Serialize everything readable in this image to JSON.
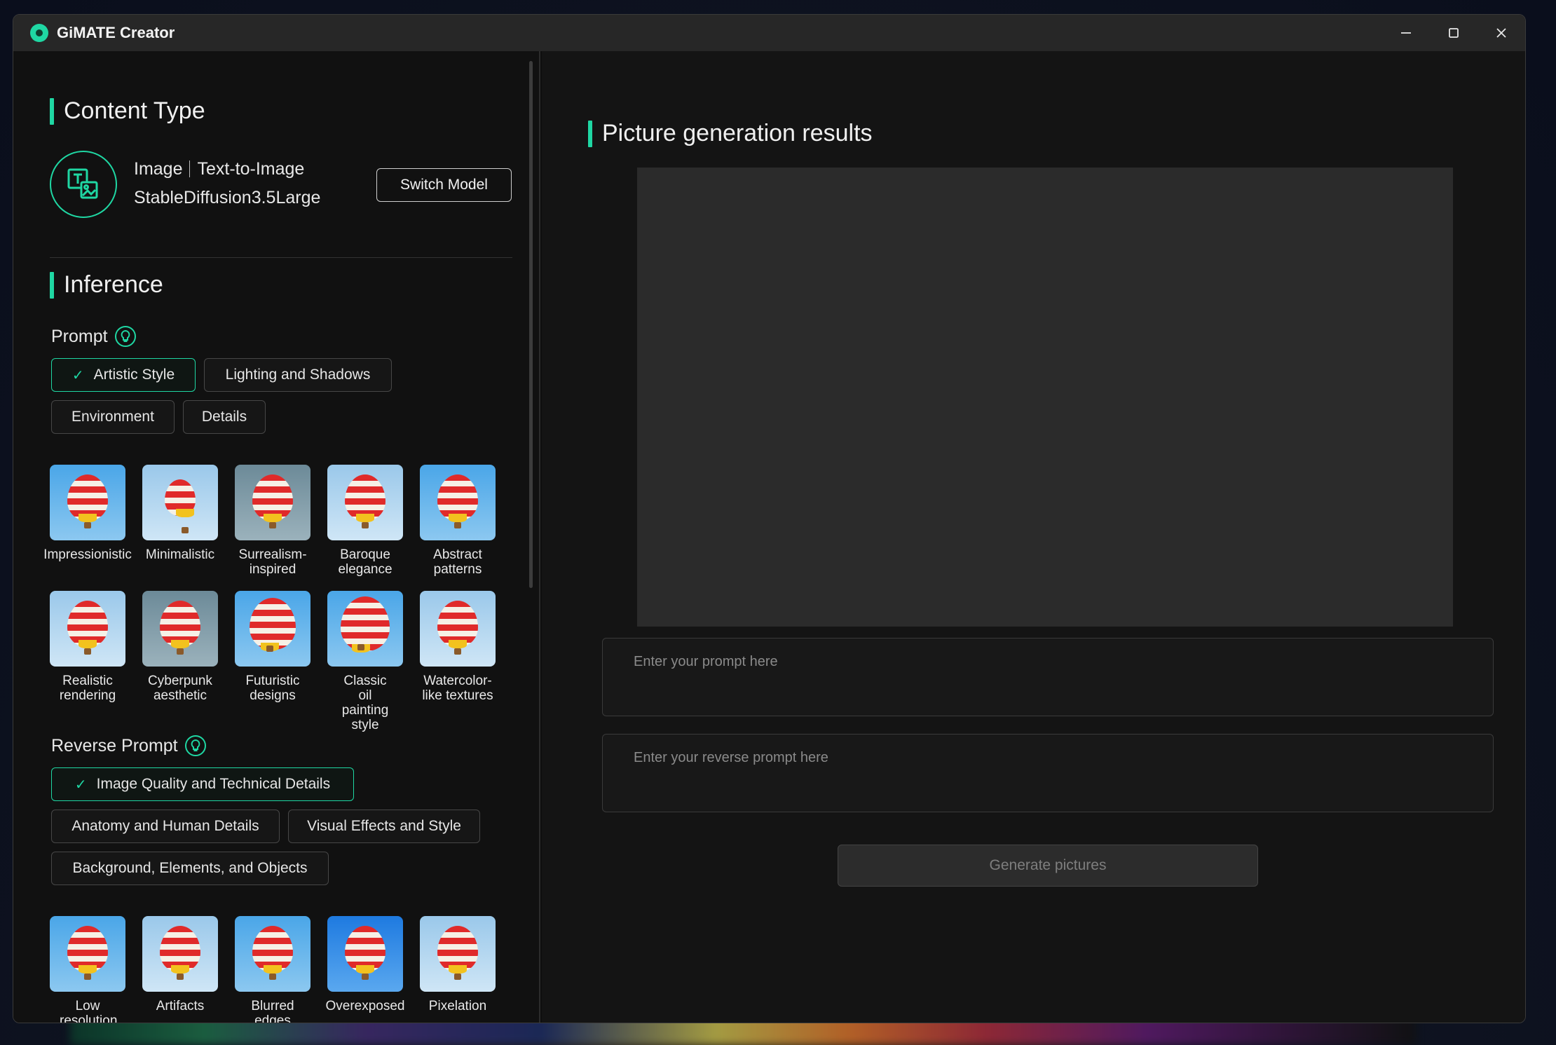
{
  "window": {
    "title": "GiMATE Creator"
  },
  "content_type": {
    "heading": "Content Type",
    "type": "Image",
    "mode": "Text-to-Image",
    "model": "StableDiffusion3.5Large",
    "switch_label": "Switch Model"
  },
  "inference": {
    "heading": "Inference",
    "prompt_label": "Prompt",
    "prompt_chips": [
      "Artistic Style",
      "Lighting and Shadows",
      "Environment",
      "Details"
    ],
    "prompt_styles": [
      "Impressionistic",
      "Minimalistic",
      "Surrealism-inspired",
      "Baroque elegance",
      "Abstract patterns",
      "Realistic rendering",
      "Cyberpunk aesthetic",
      "Futuristic designs",
      "Classic oil painting style",
      "Watercolor-like textures"
    ],
    "reverse_label": "Reverse Prompt",
    "reverse_chips": [
      "Image Quality and Technical Details",
      "Anatomy and Human Details",
      "Visual Effects and Style",
      "Background, Elements, and Objects"
    ],
    "reverse_styles": [
      "Low resolution",
      "Artifacts",
      "Blurred edges",
      "Overexposed",
      "Pixelation"
    ]
  },
  "results": {
    "heading": "Picture generation results",
    "prompt_placeholder": "Enter your prompt here",
    "reverse_placeholder": "Enter your reverse prompt here",
    "generate_label": "Generate pictures"
  },
  "colors": {
    "accent": "#1fd7a3",
    "background": "#111111"
  }
}
